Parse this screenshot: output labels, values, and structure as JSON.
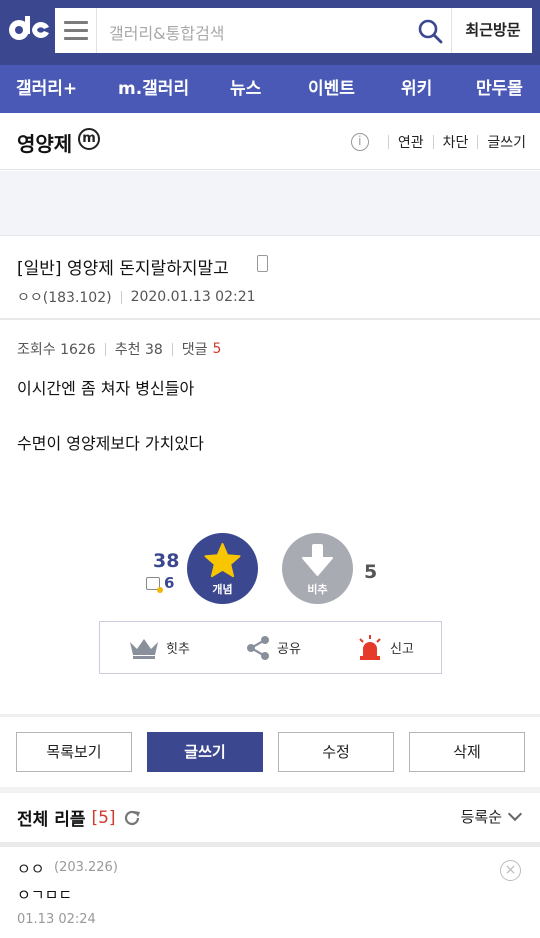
{
  "header": {
    "search_placeholder": "갤러리&통합검색",
    "recent_label": "최근방문"
  },
  "nav": [
    "갤러리+",
    "m.갤러리",
    "뉴스",
    "이벤트",
    "위키",
    "만두몰"
  ],
  "gallery": {
    "title": "영양제",
    "badge": "m",
    "actions": [
      "연관",
      "차단",
      "글쓰기"
    ]
  },
  "post": {
    "title": "[일반] 영양제 돈지랄하지말고",
    "author": "ㅇㅇ(183.102)",
    "datetime": "2020.01.13 02:21",
    "views_label": "조회수 1626",
    "recommend_label": "추천 38",
    "comments_label": "댓글",
    "comments_count": "5",
    "body_lines": [
      "이시간엔 좀 쳐자 병신들아",
      "수면이 영양제보다 가치있다"
    ]
  },
  "vote": {
    "up_count": "38",
    "fixed_count": "6",
    "up_label": "개념",
    "down_label": "비추",
    "down_count": "5"
  },
  "actions": {
    "hit": "힛추",
    "share": "공유",
    "report": "신고"
  },
  "buttons": {
    "list": "목록보기",
    "write": "글쓰기",
    "edit": "수정",
    "delete": "삭제"
  },
  "comments": {
    "heading": "전체 리플",
    "count": "[5]",
    "sort_label": "등록순",
    "items": [
      {
        "name": "ㅇㅇ",
        "ip": "(203.226)",
        "text": "ㅇㄱㅁㄷ",
        "date": "01.13 02:24"
      }
    ]
  },
  "colors": {
    "brand": "#3b4890",
    "nav": "#4a59b5",
    "accent_red": "#d13a2d",
    "star": "#f7c600"
  }
}
